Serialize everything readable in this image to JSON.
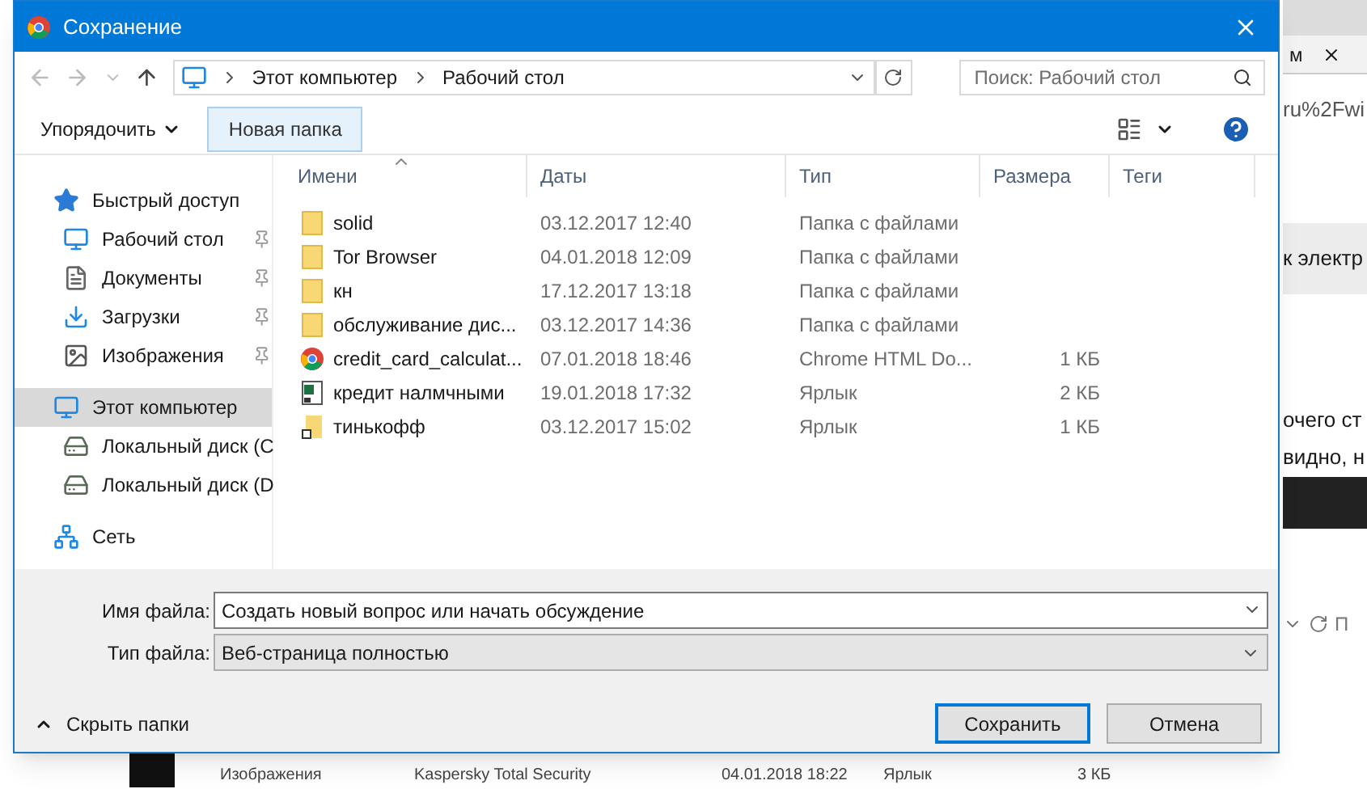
{
  "window": {
    "title": "Сохранение"
  },
  "address": {
    "parts": [
      "Этот компьютер",
      "Рабочий стол"
    ]
  },
  "search": {
    "placeholder": "Поиск: Рабочий стол"
  },
  "toolbar": {
    "organize": "Упорядочить",
    "new_folder": "Новая папка"
  },
  "sidebar": {
    "items": [
      {
        "label": "Быстрый доступ",
        "kind": "star",
        "selected": false,
        "children": [
          {
            "label": "Рабочий стол",
            "kind": "desktop",
            "selected": false,
            "pinned": true
          },
          {
            "label": "Документы",
            "kind": "documents",
            "selected": false,
            "pinned": true
          },
          {
            "label": "Загрузки",
            "kind": "downloads",
            "selected": false,
            "pinned": true
          },
          {
            "label": "Изображения",
            "kind": "pictures",
            "selected": false,
            "pinned": true
          }
        ]
      },
      {
        "label": "Этот компьютер",
        "kind": "computer",
        "selected": true,
        "children": [
          {
            "label": "Локальный диск (C",
            "kind": "drive",
            "selected": false,
            "pinned": false
          },
          {
            "label": "Локальный диск (D",
            "kind": "drive",
            "selected": false,
            "pinned": false
          }
        ]
      },
      {
        "label": "Сеть",
        "kind": "network",
        "selected": false
      }
    ]
  },
  "table": {
    "columns": [
      {
        "label": "Имени",
        "sorted": true
      },
      {
        "label": "Даты",
        "sorted": false
      },
      {
        "label": "Тип",
        "sorted": false
      },
      {
        "label": "Размера",
        "sorted": false
      },
      {
        "label": "Теги",
        "sorted": false
      }
    ],
    "rows": [
      {
        "kind": "folder",
        "name": "solid",
        "date": "03.12.2017 12:40",
        "type": "Папка с файлами"
      },
      {
        "kind": "folder",
        "name": "Tor Browser",
        "date": "04.01.2018 12:09",
        "type": "Папка с файлами"
      },
      {
        "kind": "folder",
        "name": "кн",
        "date": "17.12.2017 13:18",
        "type": "Папка с файлами"
      },
      {
        "kind": "folder",
        "name": "обслуживание дис...",
        "date": "03.12.2017 14:36",
        "type": "Папка с файлами"
      },
      {
        "kind": "chrome",
        "name": "credit_card_calculat...",
        "date": "07.01.2018 18:46",
        "type": "Chrome HTML Do...",
        "size": "1 КБ"
      },
      {
        "kind": "sheet-shortcut",
        "name": "кредит налмчными",
        "date": "19.01.2018 17:32",
        "type": "Ярлык",
        "size": "2 КБ"
      },
      {
        "kind": "shortcut",
        "name": "тинькофф",
        "date": "03.12.2017 15:02",
        "type": "Ярлык",
        "size": "1 КБ"
      }
    ]
  },
  "form": {
    "file_name_label": "Имя файла:",
    "file_name": "Создать новый вопрос или начать обсуждение",
    "file_type_label": "Тип файла:",
    "file_type": "Веб-страница полностью"
  },
  "hide_folders": "Скрыть папки",
  "buttons": [
    {
      "label": "Сохранить",
      "default": true
    },
    {
      "label": "Отмена",
      "default": false
    }
  ],
  "background": {
    "tab": "м",
    "url": "ru%2Fwi",
    "line_1": "к электр",
    "line_2": "очего ст",
    "line_3": "видно, н",
    "field_letter": "П",
    "bottom_row": {
      "name": "Изображения",
      "item": "Kaspersky Total Security",
      "date": "04.01.2018 18:22",
      "type": "Ярлык",
      "size": "3 КБ"
    }
  }
}
